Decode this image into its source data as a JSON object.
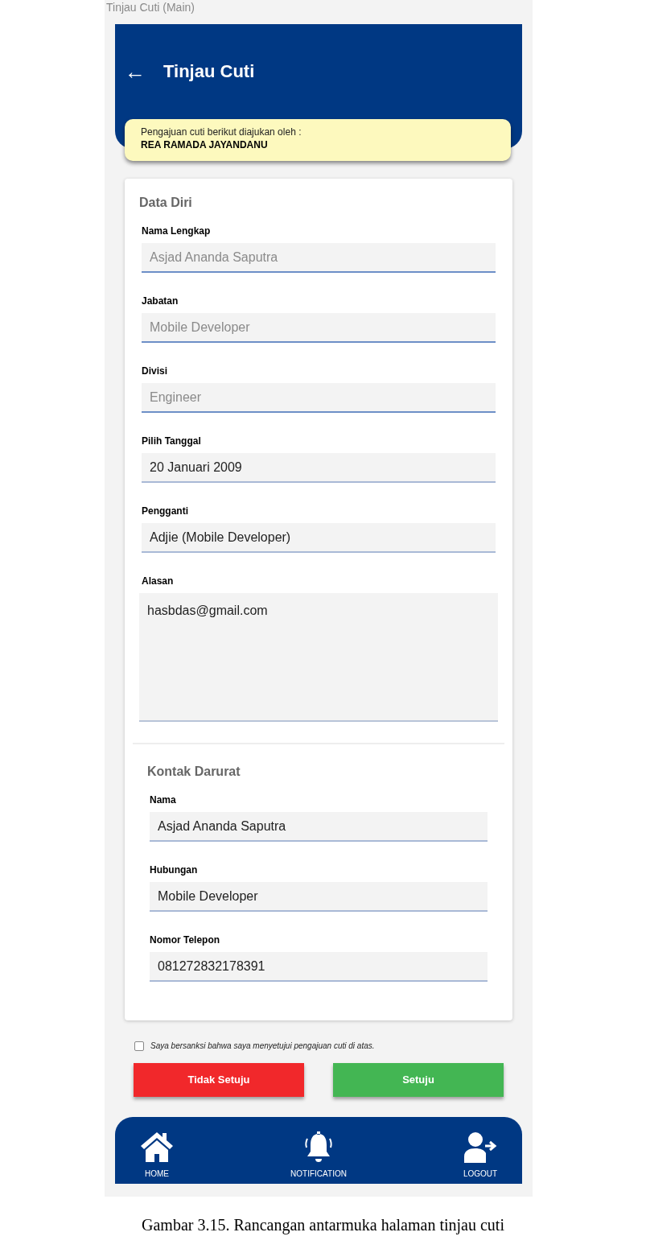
{
  "frame_label": "Tinjau Cuti (Main)",
  "header": {
    "back_icon": "←",
    "title": "Tinjau Cuti"
  },
  "notice": {
    "text": "Pengajuan cuti berikut diajukan oleh :",
    "name": "REA RAMADA JAYANDANU"
  },
  "sections": [
    {
      "title": "Data Diri",
      "fields": [
        {
          "label": "Nama Lengkap",
          "value": "Asjad Ananda Saputra",
          "disabled": true,
          "kind": "input"
        },
        {
          "label": "Jabatan",
          "value": "Mobile Developer",
          "disabled": true,
          "kind": "input"
        },
        {
          "label": "Divisi",
          "value": "Engineer",
          "disabled": true,
          "kind": "input"
        },
        {
          "label": "Pilih Tanggal",
          "value": "20 Januari 2009",
          "disabled": false,
          "kind": "input"
        },
        {
          "label": "Pengganti",
          "value": "Adjie (Mobile Developer)",
          "disabled": false,
          "kind": "input"
        },
        {
          "label": "Alasan",
          "value": "hasbdas@gmail.com",
          "disabled": false,
          "kind": "textarea"
        }
      ]
    },
    {
      "title": "Kontak Darurat",
      "fields": [
        {
          "label": "Nama",
          "value": "Asjad Ananda Saputra",
          "disabled": false,
          "kind": "input"
        },
        {
          "label": "Hubungan",
          "value": "Mobile Developer",
          "disabled": false,
          "kind": "input"
        },
        {
          "label": "Nomor Telepon",
          "value": "081272832178391",
          "disabled": false,
          "kind": "input"
        }
      ]
    }
  ],
  "agreement": {
    "text": "Saya bersanksi bahwa saya menyetujui pengajuan cuti di atas.",
    "checked": false
  },
  "buttons": [
    {
      "label": "Tidak Setuju",
      "kind": "reject"
    },
    {
      "label": "Setuju",
      "kind": "approve"
    }
  ],
  "bottom_nav": [
    {
      "label": "HOME",
      "kind": "home"
    },
    {
      "label": "NOTIFICATION",
      "kind": "notification"
    },
    {
      "label": "LOGOUT",
      "kind": "logout"
    }
  ],
  "caption": "Gambar 3.15. Rancangan antarmuka halaman tinjau cuti"
}
